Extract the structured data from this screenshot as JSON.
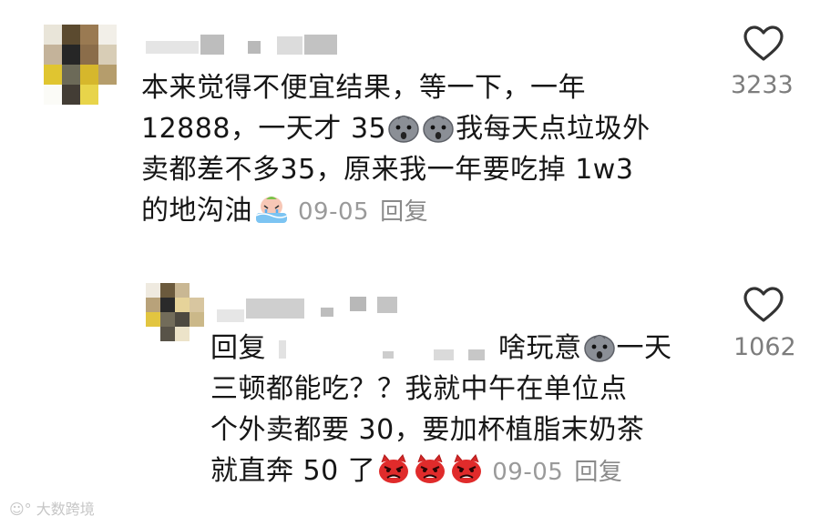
{
  "comments": [
    {
      "avatar": "blurred-avatar",
      "username": "",
      "text_lines": [
        "本来觉得不便宜结果，等一下，一年",
        "12888，一天才 35",
        "我每天点垃圾外",
        "卖都差不多35，原来我一年要吃掉 1w3",
        "的地沟油"
      ],
      "date": "09-05",
      "reply_label": "回复",
      "like_count": "3233",
      "emoji": [
        "sad-face-emoji",
        "sad-face-emoji",
        "crying-in-tub-emoji"
      ]
    },
    {
      "avatar": "blurred-avatar",
      "username": "",
      "reply_prefix": "回复",
      "text_lines": [
        "啥玩意",
        "一天",
        "三顿都能吃？？我就中午在单位点",
        "个外卖都要 30，要加杯植脂末奶茶",
        "就直奔 50 了"
      ],
      "date": "09-05",
      "reply_label": "回复",
      "like_count": "1062",
      "emoji": [
        "sad-face-emoji",
        "angry-face-emoji",
        "angry-face-emoji",
        "angry-face-emoji"
      ]
    }
  ],
  "watermark": "大数跨境",
  "colors": {
    "heart": "#333333",
    "meta": "#9a9a9a",
    "text": "#161616"
  }
}
